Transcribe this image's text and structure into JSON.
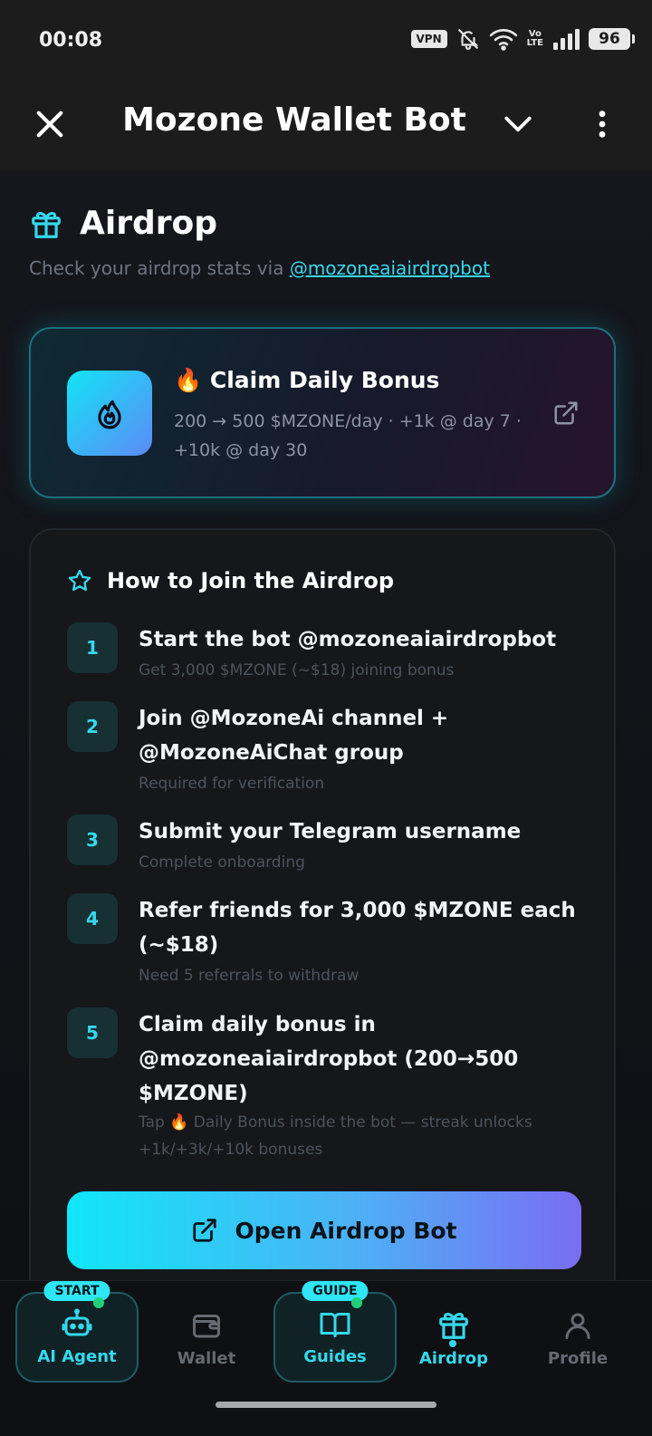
{
  "status_bar": {
    "time": "00:08",
    "vpn": "VPN",
    "volte_top": "Vo",
    "volte_bottom": "LTE",
    "battery": "96"
  },
  "title_bar": {
    "title": "Mozone Wallet Bot"
  },
  "page": {
    "title": "Airdrop",
    "subtitle_prefix": "Check your airdrop stats via ",
    "subtitle_link": "@mozoneaiairdropbot"
  },
  "bonus_card": {
    "emoji": "🔥",
    "title": "Claim Daily Bonus",
    "description": "200 → 500 $MZONE/day · +1k @ day 7 · +10k @ day 30"
  },
  "join_card": {
    "title": "How to Join the Airdrop",
    "steps": [
      {
        "num": "1",
        "title": "Start the bot @mozoneaiairdropbot",
        "sub": "Get 3,000 $MZONE (~$18) joining bonus"
      },
      {
        "num": "2",
        "title": "Join @MozoneAi channel + @MozoneAiChat group",
        "sub": "Required for verification"
      },
      {
        "num": "3",
        "title": "Submit your Telegram username",
        "sub": "Complete onboarding"
      },
      {
        "num": "4",
        "title": "Refer friends for 3,000 $MZONE each (~$18)",
        "sub": "Need 5 referrals to withdraw"
      },
      {
        "num": "5",
        "title": "Claim daily bonus in @mozoneaiairdropbot (200→500 $MZONE)",
        "sub": "Tap 🔥 Daily Bonus inside the bot — streak unlocks +1k/+3k/+10k bonuses"
      }
    ],
    "cta_label": "Open Airdrop Bot"
  },
  "bottom_nav": {
    "items": [
      {
        "label": "AI Agent",
        "badge": "START"
      },
      {
        "label": "Wallet"
      },
      {
        "label": "Guides",
        "badge": "GUIDE"
      },
      {
        "label": "Airdrop"
      },
      {
        "label": "Profile"
      }
    ]
  },
  "colors": {
    "accent": "#35d8ec",
    "background": "#101014",
    "cta_gradient_start": "#10e6f7",
    "cta_gradient_end": "#7a6df3"
  }
}
